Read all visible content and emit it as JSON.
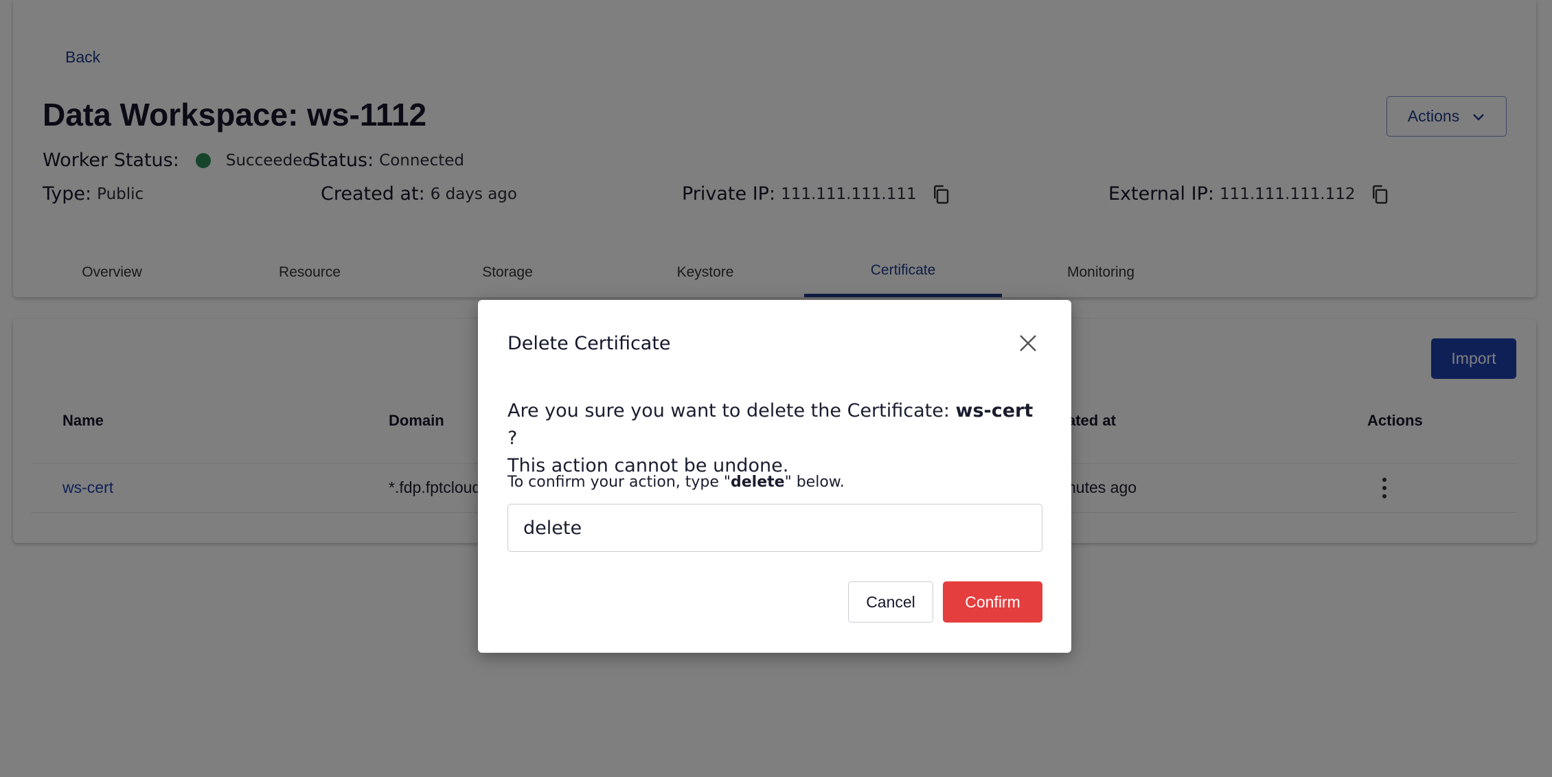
{
  "header": {
    "back_label": "Back",
    "title": "Data Workspace: ws-1112",
    "actions_label": "Actions"
  },
  "info": {
    "worker_status_label": "Worker Status:",
    "worker_status_value": "Succeeded",
    "status_label": "Status:",
    "status_value": "Connected",
    "type_label": "Type:",
    "type_value": "Public",
    "created_label": "Created at:",
    "created_value": "6 days ago",
    "private_ip_label": "Private IP:",
    "private_ip_value": "111.111.111.111",
    "external_ip_label": "External IP:",
    "external_ip_value": "111.111.111.112"
  },
  "tabs": [
    {
      "label": "Overview"
    },
    {
      "label": "Resource"
    },
    {
      "label": "Storage"
    },
    {
      "label": "Keystore"
    },
    {
      "label": "Certificate"
    },
    {
      "label": "Monitoring"
    }
  ],
  "active_tab": "Certificate",
  "table": {
    "import_label": "Import",
    "columns": [
      "Name",
      "Domain",
      "ated at",
      "Actions"
    ],
    "rows": [
      {
        "name": "ws-cert",
        "domain": "*.fdp.fptcloud",
        "created": "nutes ago"
      }
    ]
  },
  "modal": {
    "title": "Delete Certificate",
    "message_prefix": "Are you sure you want to delete the Certificate: ",
    "certificate_name": "ws-cert",
    "message_suffix": " ?",
    "message_line2": "This action cannot be undone.",
    "hint_prefix": "To confirm your action, type \"",
    "hint_keyword": "delete",
    "hint_suffix": "\" below.",
    "input_value": "delete",
    "cancel_label": "Cancel",
    "confirm_label": "Confirm"
  },
  "colors": {
    "accent": "#1e40af",
    "status_ok": "#2e8b57",
    "danger": "#e53e3e"
  }
}
